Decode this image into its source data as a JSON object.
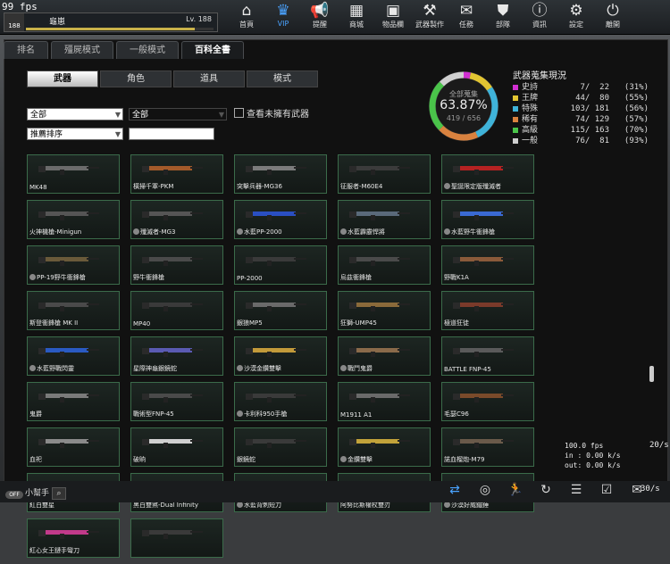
{
  "fps": "99 fps",
  "player": {
    "rank": "188",
    "name": "龜崽",
    "level": "Lv. 188",
    "xp_fraction": 0.9
  },
  "nav": [
    {
      "label": "首頁",
      "icon": "home-icon",
      "glyph": "⌂"
    },
    {
      "label": "VIP",
      "icon": "crown-icon",
      "glyph": "♛"
    },
    {
      "label": "提醒",
      "icon": "megaphone-icon",
      "glyph": "📢"
    },
    {
      "label": "商城",
      "icon": "shop-icon",
      "glyph": "▦"
    },
    {
      "label": "物品欄",
      "icon": "briefcase-icon",
      "glyph": "▣"
    },
    {
      "label": "武器製作",
      "icon": "crafting-icon",
      "glyph": "⚒"
    },
    {
      "label": "任務",
      "icon": "ticket-icon",
      "glyph": "✉"
    },
    {
      "label": "部隊",
      "icon": "shield-icon",
      "glyph": "⛊"
    },
    {
      "label": "資訊",
      "icon": "info-icon",
      "glyph": "ⓘ"
    },
    {
      "label": "設定",
      "icon": "gear-icon",
      "glyph": "⚙"
    },
    {
      "label": "離開",
      "icon": "power-icon",
      "glyph": "⏻"
    }
  ],
  "tabs": [
    "排名",
    "殭屍模式",
    "一般模式",
    "百科全書"
  ],
  "subtabs": [
    "武器",
    "角色",
    "道具",
    "模式"
  ],
  "filters": {
    "filter1": "全部",
    "filter2": "全部",
    "sort": "推薦排序",
    "search": ""
  },
  "show_unowned_label": "查看未擁有武器",
  "summary": {
    "label": "全部蒐集",
    "percent": "63.87%",
    "count": "419 / 656",
    "fraction": 0.6387
  },
  "collection": {
    "title": "武器蒐集現況",
    "rows": [
      {
        "name": "史詩",
        "value": "7/  22",
        "pct": "(31%)",
        "color": "#d12fd1"
      },
      {
        "name": "王牌",
        "value": "44/  80",
        "pct": "(55%)",
        "color": "#e2c532"
      },
      {
        "name": "特殊",
        "value": "103/ 181",
        "pct": "(56%)",
        "color": "#3fb3d9"
      },
      {
        "name": "稀有",
        "value": "74/ 129",
        "pct": "(57%)",
        "color": "#d9823f"
      },
      {
        "name": "高級",
        "value": "115/ 163",
        "pct": "(70%)",
        "color": "#4ac44a"
      },
      {
        "name": "一般",
        "value": "76/  81",
        "pct": "(93%)",
        "color": "#cfcfcf"
      }
    ]
  },
  "weapons": [
    {
      "name": "MK48",
      "c": "#6b6b6b",
      "sym": false
    },
    {
      "name": "橫掃千軍-PKM",
      "c": "#a35a2a",
      "sym": false
    },
    {
      "name": "突擊兵器-MG36",
      "c": "#7b7b7b",
      "sym": false
    },
    {
      "name": "征服者-M60E4",
      "c": "#3b3b3b",
      "sym": false
    },
    {
      "name": "聖誕限定版殲滅者",
      "c": "#b52222",
      "sym": true
    },
    {
      "name": "火神機槍-Minigun",
      "c": "#555555",
      "sym": false
    },
    {
      "name": "殲滅者-MG3",
      "c": "#555555",
      "sym": true
    },
    {
      "name": "水藍PP-2000",
      "c": "#2a4fc2",
      "sym": true
    },
    {
      "name": "水藍霹靂悍將",
      "c": "#5a6a7a",
      "sym": true
    },
    {
      "name": "水藍野牛衝鋒槍",
      "c": "#3a6ad2",
      "sym": true
    },
    {
      "name": "PP-19野牛衝鋒槍",
      "c": "#6a5a3a",
      "sym": true
    },
    {
      "name": "野牛衝鋒槍",
      "c": "#4a4a4a",
      "sym": false
    },
    {
      "name": "PP-2000",
      "c": "#3a3a3a",
      "sym": false
    },
    {
      "name": "烏茲衝鋒槍",
      "c": "#4a4a4a",
      "sym": false
    },
    {
      "name": "野戰K1A",
      "c": "#8a5a3a",
      "sym": false
    },
    {
      "name": "斯登衝鋒槍 MK II",
      "c": "#4a4a4a",
      "sym": false
    },
    {
      "name": "MP40",
      "c": "#3a3a3a",
      "sym": false
    },
    {
      "name": "銀狼MP5",
      "c": "#6a6a6a",
      "sym": false
    },
    {
      "name": "狂獅-UMP45",
      "c": "#8a6a3a",
      "sym": false
    },
    {
      "name": "極道狂徒",
      "c": "#7a3a2a",
      "sym": false
    },
    {
      "name": "水藍野戰閃靈",
      "c": "#2a5ac2",
      "sym": true
    },
    {
      "name": "星際神龜銀鏡蛇",
      "c": "#5a5ab2",
      "sym": false
    },
    {
      "name": "沙漠金鑽雙擊",
      "c": "#c29a3a",
      "sym": true
    },
    {
      "name": "戰鬥鬼爵",
      "c": "#8a6a4a",
      "sym": true
    },
    {
      "name": "BATTLE FNP-45",
      "c": "#5a5a5a",
      "sym": false
    },
    {
      "name": "鬼爵",
      "c": "#7a7a7a",
      "sym": false
    },
    {
      "name": "戰術型FNP-45",
      "c": "#4a4a4a",
      "sym": false
    },
    {
      "name": "卡利科950手槍",
      "c": "#3a3a3a",
      "sym": true
    },
    {
      "name": "M1911 A1",
      "c": "#6a6a6a",
      "sym": false
    },
    {
      "name": "毛瑟C96",
      "c": "#7a4a2a",
      "sym": false
    },
    {
      "name": "血祀",
      "c": "#8a8a8a",
      "sym": false
    },
    {
      "name": "破晌",
      "c": "#d0d0d0",
      "sym": false
    },
    {
      "name": "銀鏡蛇",
      "c": "#3a3a3a",
      "sym": false
    },
    {
      "name": "金鑽雙擊",
      "c": "#c2a23a",
      "sym": true
    },
    {
      "name": "諾血榴炮-M79",
      "c": "#6a5a4a",
      "sym": false
    },
    {
      "name": "紅白雙星",
      "c": "#c23a3a",
      "sym": false
    },
    {
      "name": "黑白雙煞-Dual Infinity",
      "c": "#8a8a8a",
      "sym": false
    },
    {
      "name": "水藍背刺短刀",
      "c": "#2a6ac2",
      "sym": true
    },
    {
      "name": "阿努比斯權杖雙刃",
      "c": "#b28a3a",
      "sym": false
    },
    {
      "name": "沙漠好威鐵錘",
      "c": "#c2a26a",
      "sym": true
    },
    {
      "name": "紅心女王鏈手彎刀",
      "c": "#c23a8a",
      "sym": false
    },
    {
      "name": "",
      "c": "#3a3a3a",
      "sym": false
    }
  ],
  "helper": {
    "label": "小幫手",
    "toggle": "OFF"
  },
  "bottom_icons": [
    {
      "icon": "refresh-icon",
      "glyph": "⇄"
    },
    {
      "icon": "compass-icon",
      "glyph": "◎"
    },
    {
      "icon": "runner-icon",
      "glyph": "🏃"
    },
    {
      "icon": "loading-icon",
      "glyph": "↻"
    },
    {
      "icon": "checklist-icon",
      "glyph": "☰"
    },
    {
      "icon": "calendar-icon",
      "glyph": "☑"
    },
    {
      "icon": "chat-icon",
      "glyph": "✉"
    }
  ],
  "net": {
    "fps": "100.0 fps",
    "in": "in : 0.00 k/s",
    "out": "out: 0.00 k/s",
    "side": "20/s",
    "side2": "30/s"
  }
}
